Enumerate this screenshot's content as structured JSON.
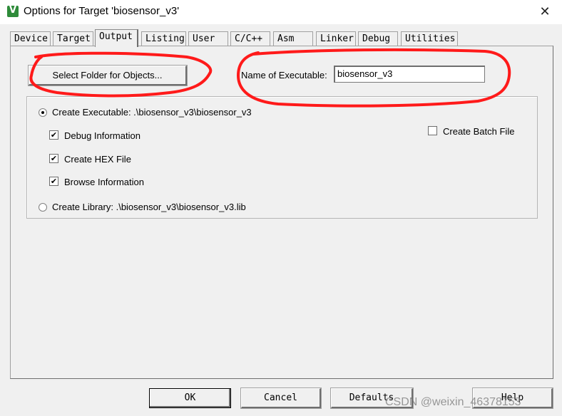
{
  "window": {
    "title": "Options for Target 'biosensor_v3'",
    "close_glyph": "✕"
  },
  "tabs": [
    {
      "label": "Device"
    },
    {
      "label": "Target"
    },
    {
      "label": "Output",
      "active": true
    },
    {
      "label": "Listing"
    },
    {
      "label": "User"
    },
    {
      "label": "C/C++"
    },
    {
      "label": "Asm"
    },
    {
      "label": "Linker"
    },
    {
      "label": "Debug"
    },
    {
      "label": "Utilities"
    }
  ],
  "output": {
    "select_folder_label": "Select Folder for Objects...",
    "exe_name_label": "Name of Executable:",
    "exe_name_value": "biosensor_v3",
    "create_executable_label": "Create Executable:  .\\biosensor_v3\\biosensor_v3",
    "create_executable_selected": true,
    "debug_info_label": "Debug Information",
    "debug_info_checked": true,
    "create_hex_label": "Create HEX File",
    "create_hex_checked": true,
    "browse_info_label": "Browse Information",
    "browse_info_checked": true,
    "create_library_label": "Create Library:  .\\biosensor_v3\\biosensor_v3.lib",
    "create_library_selected": false,
    "create_batch_label": "Create Batch File",
    "create_batch_checked": false
  },
  "footer": {
    "ok_label": "OK",
    "cancel_label": "Cancel",
    "defaults_label": "Defaults",
    "help_label": "Help"
  },
  "watermark": "CSDN @weixin_46378153",
  "colors": {
    "annotation": "#ff1a1a",
    "dialog_bg": "#f0f0f0",
    "icon": "#2e8b3a"
  },
  "icons": {
    "app": "keil-uvision-icon",
    "close": "close-icon"
  },
  "check_glyph": "✔"
}
